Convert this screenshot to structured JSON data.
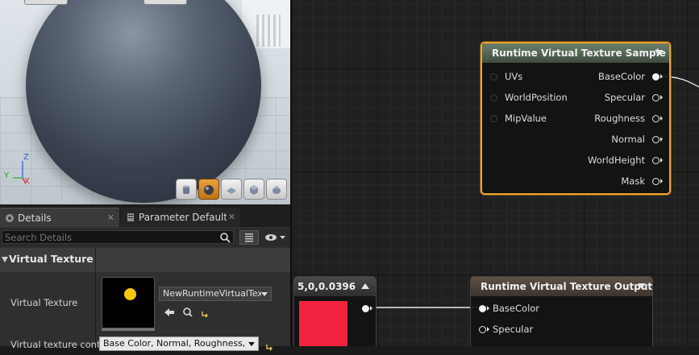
{
  "viewport": {
    "axis_labels": {
      "z": "Z",
      "y": "Y",
      "x": "X"
    },
    "toolbar_buttons": [
      {
        "name": "preview-cylinder-button",
        "icon": "cylinder-icon",
        "active": false
      },
      {
        "name": "preview-sphere-button",
        "icon": "sphere-icon",
        "active": true
      },
      {
        "name": "preview-plane-button",
        "icon": "plane-icon",
        "active": false
      },
      {
        "name": "preview-cube-button",
        "icon": "cube-icon",
        "active": false
      },
      {
        "name": "preview-custom-mesh-button",
        "icon": "teapot-icon",
        "active": false
      }
    ]
  },
  "details_panel": {
    "tabs": [
      {
        "label": "Details",
        "close": "✕",
        "icon": "details-icon"
      },
      {
        "label": "Parameter Defaults",
        "close": "✕",
        "icon": "parameter-icon"
      }
    ],
    "search_placeholder": "Search Details",
    "category": "Virtual Texture",
    "properties": {
      "virtual_texture_label": "Virtual Texture",
      "virtual_texture_value": "NewRuntimeVirtualTexture",
      "contents_label": "Virtual texture content",
      "contents_value": "Base Color, Normal, Roughness, Specular"
    }
  },
  "graph": {
    "sample_node": {
      "title": "Runtime Virtual Texture Sample",
      "inputs": [
        "UVs",
        "WorldPosition",
        "MipValue"
      ],
      "outputs": [
        "BaseColor",
        "Specular",
        "Roughness",
        "Normal",
        "WorldHeight",
        "Mask"
      ]
    },
    "output_node": {
      "title": "Runtime Virtual Texture Output",
      "inputs": [
        "BaseColor",
        "Specular"
      ]
    },
    "vector_node": {
      "title": "5,0,0.0396",
      "swatch_color": "#f2233f"
    }
  },
  "colors": {
    "selection_outline": "#f0a431",
    "sample_header": "#5a6d5a",
    "output_header": "#52463c"
  }
}
